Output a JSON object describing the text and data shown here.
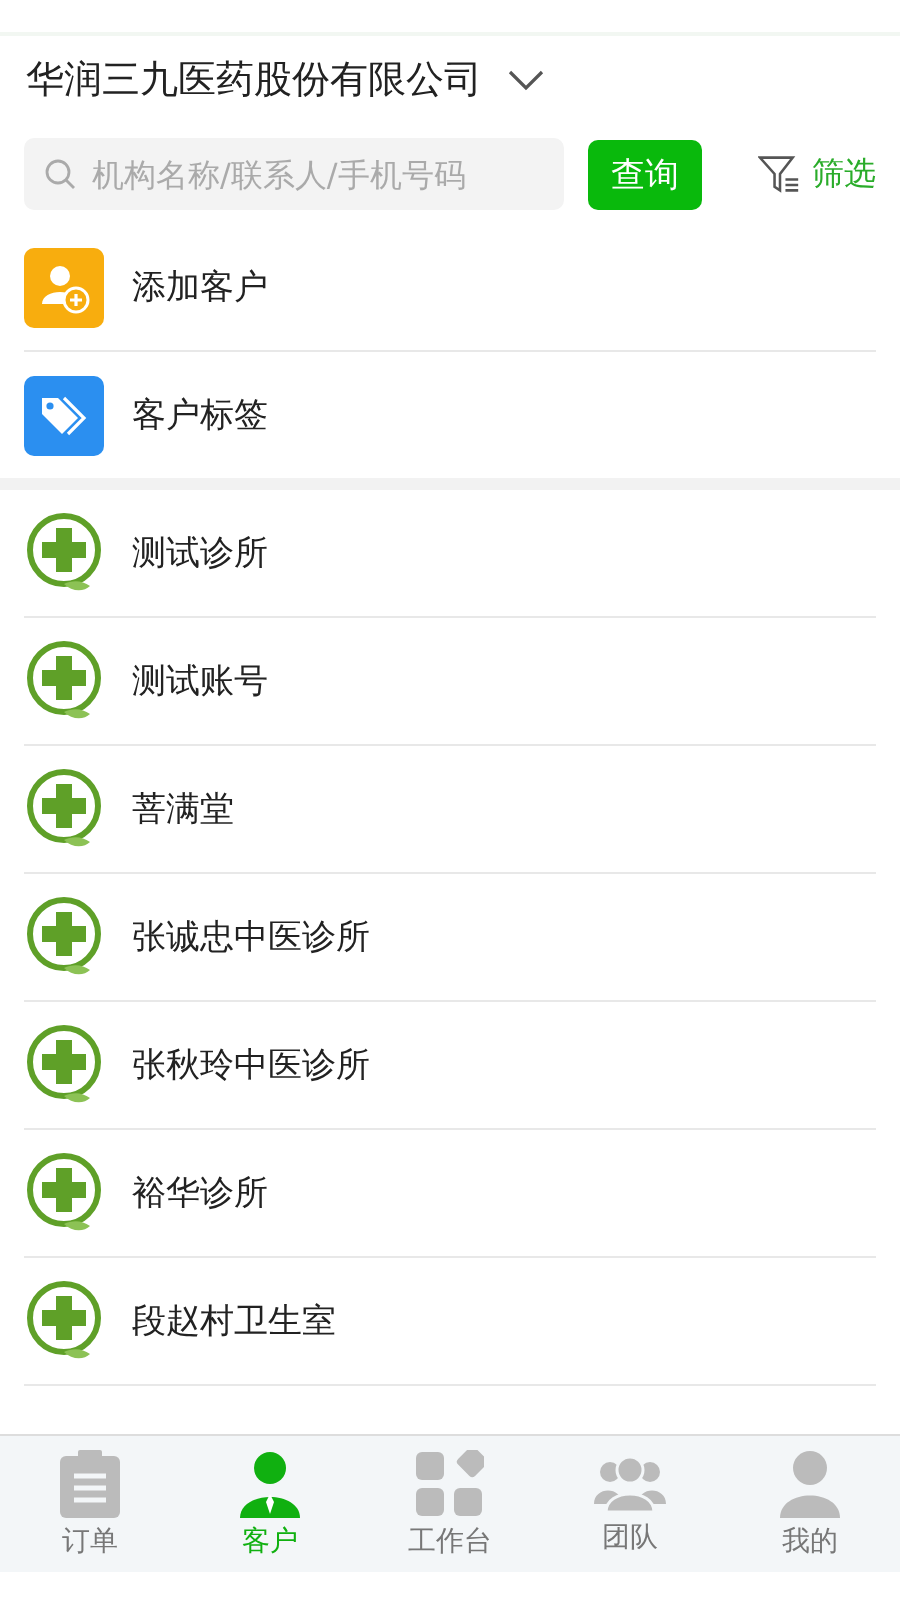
{
  "header": {
    "title": "华润三九医药股份有限公司"
  },
  "search": {
    "placeholder": "机构名称/联系人/手机号码",
    "button": "查询",
    "filter": "筛选"
  },
  "actions": [
    {
      "kind": "add",
      "label": "添加客户"
    },
    {
      "kind": "tag",
      "label": "客户标签"
    }
  ],
  "clinics": [
    {
      "name": "测试诊所"
    },
    {
      "name": "测试账号"
    },
    {
      "name": "菩满堂"
    },
    {
      "name": "张诚忠中医诊所"
    },
    {
      "name": "张秋玲中医诊所"
    },
    {
      "name": "裕华诊所"
    },
    {
      "name": "段赵村卫生室"
    }
  ],
  "tabs": [
    {
      "kind": "orders",
      "label": "订单",
      "selected": false
    },
    {
      "kind": "customers",
      "label": "客户",
      "selected": true
    },
    {
      "kind": "workbench",
      "label": "工作台",
      "selected": false
    },
    {
      "kind": "team",
      "label": "团队",
      "selected": false
    },
    {
      "kind": "me",
      "label": "我的",
      "selected": false
    }
  ]
}
